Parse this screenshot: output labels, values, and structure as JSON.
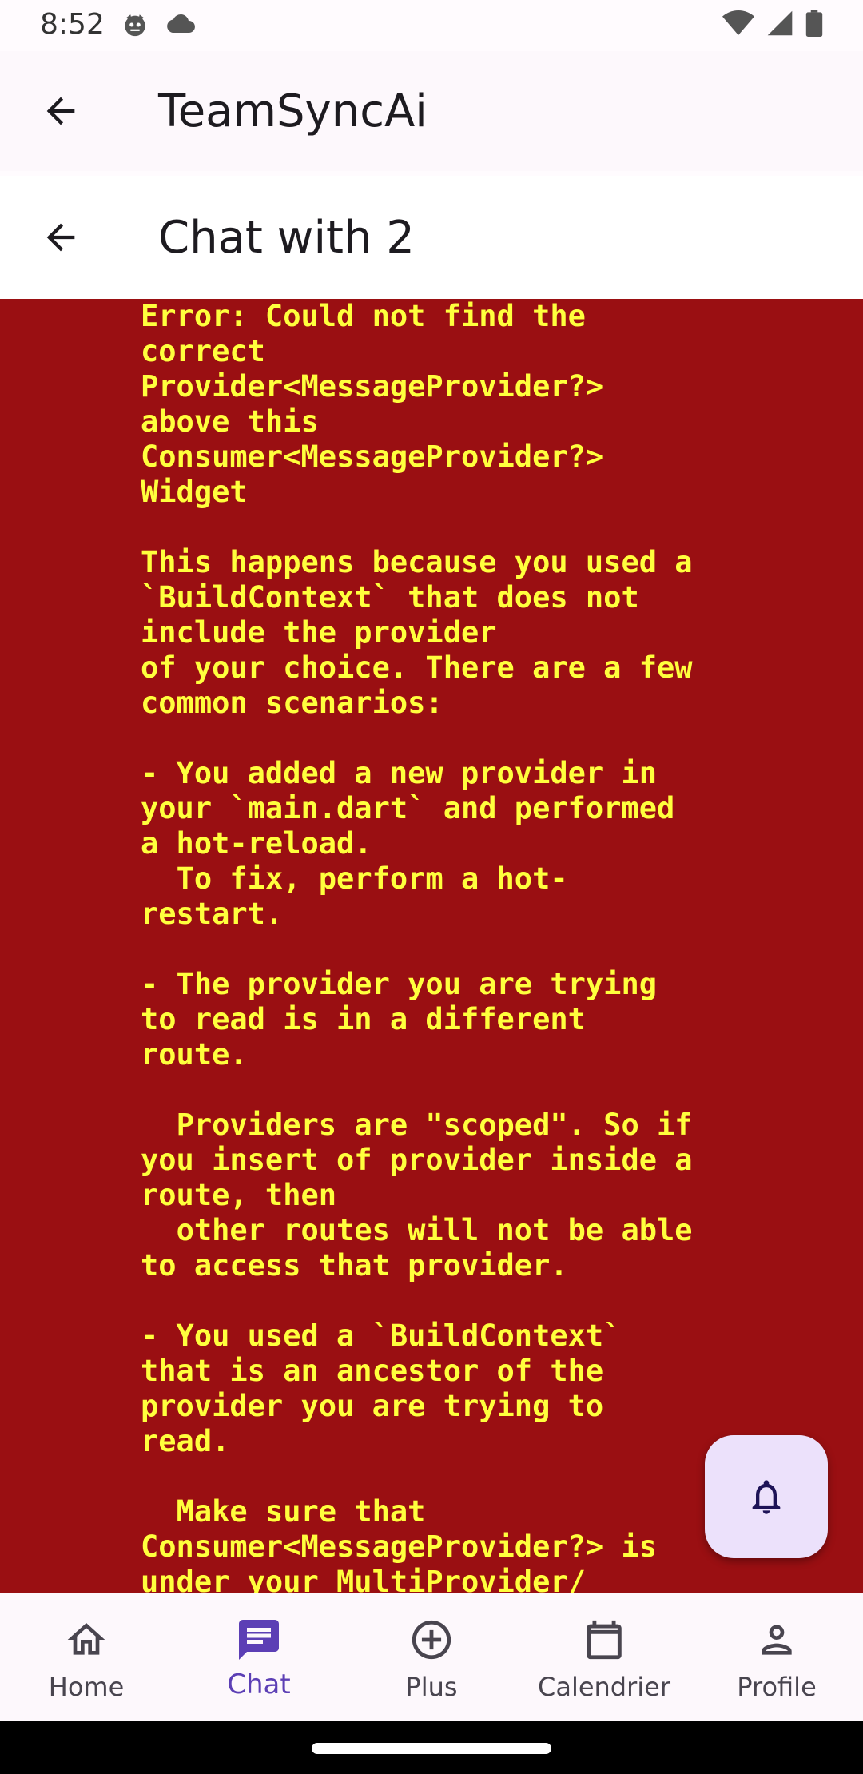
{
  "status_bar": {
    "time": "8:52",
    "icons": [
      "cat-face-icon",
      "cloud-icon",
      "wifi-icon",
      "signal-icon",
      "battery-icon"
    ]
  },
  "appbar_main": {
    "title": "TeamSyncAi",
    "back_icon": "arrow-back-icon"
  },
  "appbar_chat": {
    "title": "Chat with 2",
    "back_icon": "arrow-back-icon"
  },
  "error": {
    "text": "Error: Could not find the\ncorrect\nProvider<MessageProvider?>\nabove this\nConsumer<MessageProvider?>\nWidget\n\nThis happens because you used a\n`BuildContext` that does not\ninclude the provider\nof your choice. There are a few\ncommon scenarios:\n\n- You added a new provider in\nyour `main.dart` and performed\na hot-reload.\n  To fix, perform a hot-\nrestart.\n\n- The provider you are trying\nto read is in a different\nroute.\n\n  Providers are \"scoped\". So if\nyou insert of provider inside a\nroute, then\n  other routes will not be able\nto access that provider.\n\n- You used a `BuildContext`\nthat is an ancestor of the\nprovider you are trying to\nread.\n\n  Make sure that\nConsumer<MessageProvider?> is\nunder your MultiProvider/",
    "background": "#9a0f12",
    "text_color": "#ffff3d"
  },
  "fab": {
    "icon": "bell-icon",
    "color": "#ece1fb"
  },
  "bottom_nav": {
    "active_color": "#5c3fb5",
    "items": [
      {
        "label": "Home",
        "icon": "home-icon"
      },
      {
        "label": "Chat",
        "icon": "chat-icon",
        "active": true
      },
      {
        "label": "Plus",
        "icon": "add-circle-icon"
      },
      {
        "label": "Calendrier",
        "icon": "calendar-icon"
      },
      {
        "label": "Profile",
        "icon": "person-icon"
      }
    ]
  }
}
